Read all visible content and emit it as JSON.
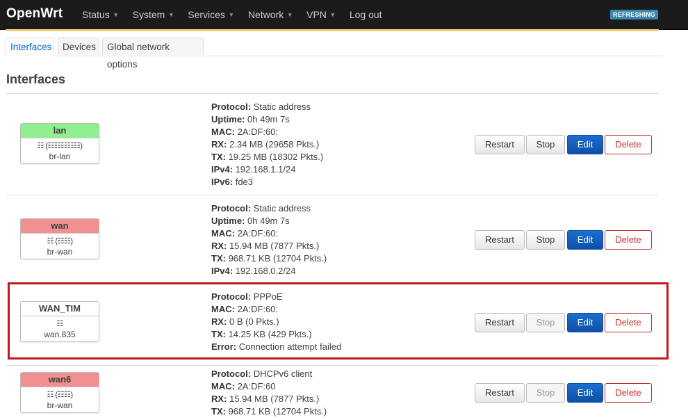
{
  "header": {
    "brand": "OpenWrt",
    "nav": [
      "Status",
      "System",
      "Services",
      "Network",
      "VPN"
    ],
    "logout": "Log out",
    "refresh_badge": "REFRESHING"
  },
  "tabs": [
    "Interfaces",
    "Devices",
    "Global network options"
  ],
  "section_title": "Interfaces",
  "buttons": {
    "restart": "Restart",
    "stop": "Stop",
    "edit": "Edit",
    "delete": "Delete"
  },
  "interfaces": [
    {
      "name": "lan",
      "status_color": "green",
      "ports": "☷ (☷☷☷☷☷)",
      "device": "br-lan",
      "info": [
        {
          "label": "Protocol:",
          "value": "Static address"
        },
        {
          "label": "Uptime:",
          "value": "0h 49m 7s"
        },
        {
          "label": "MAC:",
          "value": "2A:DF:60:"
        },
        {
          "label": "RX:",
          "value": "2.34 MB (29658 Pkts.)"
        },
        {
          "label": "TX:",
          "value": "19.25 MB (18302 Pkts.)"
        },
        {
          "label": "IPv4:",
          "value": "192.168.1.1/24"
        },
        {
          "label": "IPv6:",
          "value": "fde3"
        }
      ],
      "stop_disabled": false
    },
    {
      "name": "wan",
      "status_color": "red",
      "ports": "☷ (☷☷)",
      "device": "br-wan",
      "info": [
        {
          "label": "Protocol:",
          "value": "Static address"
        },
        {
          "label": "Uptime:",
          "value": "0h 49m 7s"
        },
        {
          "label": "MAC:",
          "value": "2A:DF:60:"
        },
        {
          "label": "RX:",
          "value": "15.94 MB (7877 Pkts.)"
        },
        {
          "label": "TX:",
          "value": "968.71 KB (12704 Pkts.)"
        },
        {
          "label": "IPv4:",
          "value": "192.168.0.2/24"
        }
      ],
      "stop_disabled": false
    },
    {
      "name": "WAN_TIM",
      "status_color": "white",
      "ports": "☷",
      "device": "wan.835",
      "info": [
        {
          "label": "Protocol:",
          "value": "PPPoE"
        },
        {
          "label": "MAC:",
          "value": "2A:DF:60:"
        },
        {
          "label": "RX:",
          "value": "0 B (0 Pkts.)"
        },
        {
          "label": "TX:",
          "value": "14.25 KB (429 Pkts.)"
        },
        {
          "label": "Error:",
          "value": "Connection attempt failed"
        }
      ],
      "stop_disabled": true
    },
    {
      "name": "wan6",
      "status_color": "red",
      "ports": "☷ (☷☷)",
      "device": "br-wan",
      "info": [
        {
          "label": "Protocol:",
          "value": "DHCPv6 client"
        },
        {
          "label": "MAC:",
          "value": "2A:DF:60"
        },
        {
          "label": "RX:",
          "value": "15.94 MB (7877 Pkts.)"
        },
        {
          "label": "TX:",
          "value": "968.71 KB (12704 Pkts.)"
        }
      ],
      "stop_disabled": true
    }
  ]
}
